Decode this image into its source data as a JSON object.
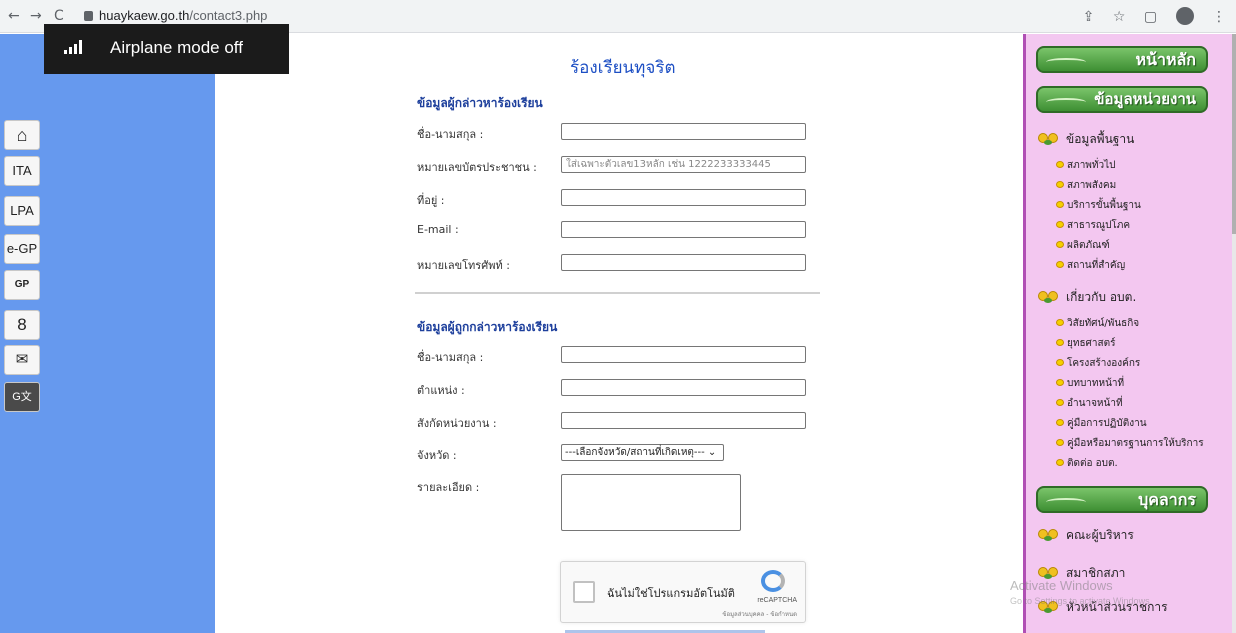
{
  "browser": {
    "back": "←",
    "forward": "→",
    "reload": "C",
    "url_domain": "huaykaew.go.th",
    "url_path": "/contact3.php"
  },
  "toast": {
    "text": "Airplane mode off"
  },
  "left_toolbar": {
    "collapse": "«",
    "buttons": [
      {
        "icon": "home-icon",
        "label": "⌂"
      },
      {
        "label": "ITA"
      },
      {
        "label": "LPA"
      },
      {
        "label": "e-GP"
      },
      {
        "icon": "egp-globe-icon",
        "label": "GP"
      },
      {
        "icon": "user-icon",
        "label": "8"
      },
      {
        "icon": "mail-icon",
        "label": "✉"
      },
      {
        "icon": "translate-icon",
        "label": "G文"
      }
    ]
  },
  "form": {
    "title": "ร้องเรียนทุจริต",
    "complainant_heading": "ข้อมูลผู้กล่าวหาร้องเรียน",
    "complainant_fields": [
      {
        "label": "ชื่อ-นามสกุล :",
        "placeholder": ""
      },
      {
        "label": "หมายเลขบัตรประชาชน :",
        "placeholder": "ใส่เฉพาะตัวเลข13หลัก เช่น 1222233333445"
      },
      {
        "label": "ที่อยู่ :",
        "placeholder": ""
      },
      {
        "label": "E-mail :",
        "placeholder": ""
      },
      {
        "label": "หมายเลขโทรศัพท์ :",
        "placeholder": ""
      }
    ],
    "accused_heading": "ข้อมูลผู้ถูกกล่าวหาร้องเรียน",
    "accused_fields": [
      {
        "label": "ชื่อ-นามสกุล :",
        "placeholder": ""
      },
      {
        "label": "ตำแหน่ง :",
        "placeholder": ""
      },
      {
        "label": "สังกัดหน่วยงาน :",
        "placeholder": ""
      }
    ],
    "province_label": "จังหวัด :",
    "province_select": "---เลือกจังหวัด/สถานที่เกิดเหตุ--- ⌄",
    "detail_label": "รายละเอียด :",
    "captcha": {
      "text": "ฉันไม่ใช่โปรแกรมอัตโนมัติ",
      "brand": "reCAPTCHA",
      "terms": "ข้อมูลส่วนบุคคล - ข้อกำหนด"
    }
  },
  "right_menu": {
    "home_button": "หน้าหลัก",
    "info_button": "ข้อมูลหน่วยงาน",
    "basic_info": "ข้อมูลพื้นฐาน",
    "basic_items": [
      "สภาพทั่วไป",
      "สภาพสังคม",
      "บริการขั้นพื้นฐาน",
      "สาธารณูปโภค",
      "ผลิตภัณฑ์",
      "สถานที่สำคัญ"
    ],
    "about": "เกี่ยวกับ อบต.",
    "about_items": [
      "วิสัยทัศน์/พันธกิจ",
      "ยุทธศาสตร์",
      "โครงสร้างองค์กร",
      "บทบาทหน้าที่",
      "อำนาจหน้าที่",
      "คู่มือการปฏิบัติงาน",
      "คู่มือหรือมาตรฐานการให้บริการ",
      "ติดต่อ อบต."
    ],
    "personnel_button": "บุคลากร",
    "personnel_items": [
      "คณะผู้บริหาร",
      "สมาชิกสภา",
      "หัวหน้าส่วนราชการ"
    ]
  },
  "watermark": {
    "line1": "Activate Windows",
    "line2": "Go to Settings to activate Windows."
  }
}
